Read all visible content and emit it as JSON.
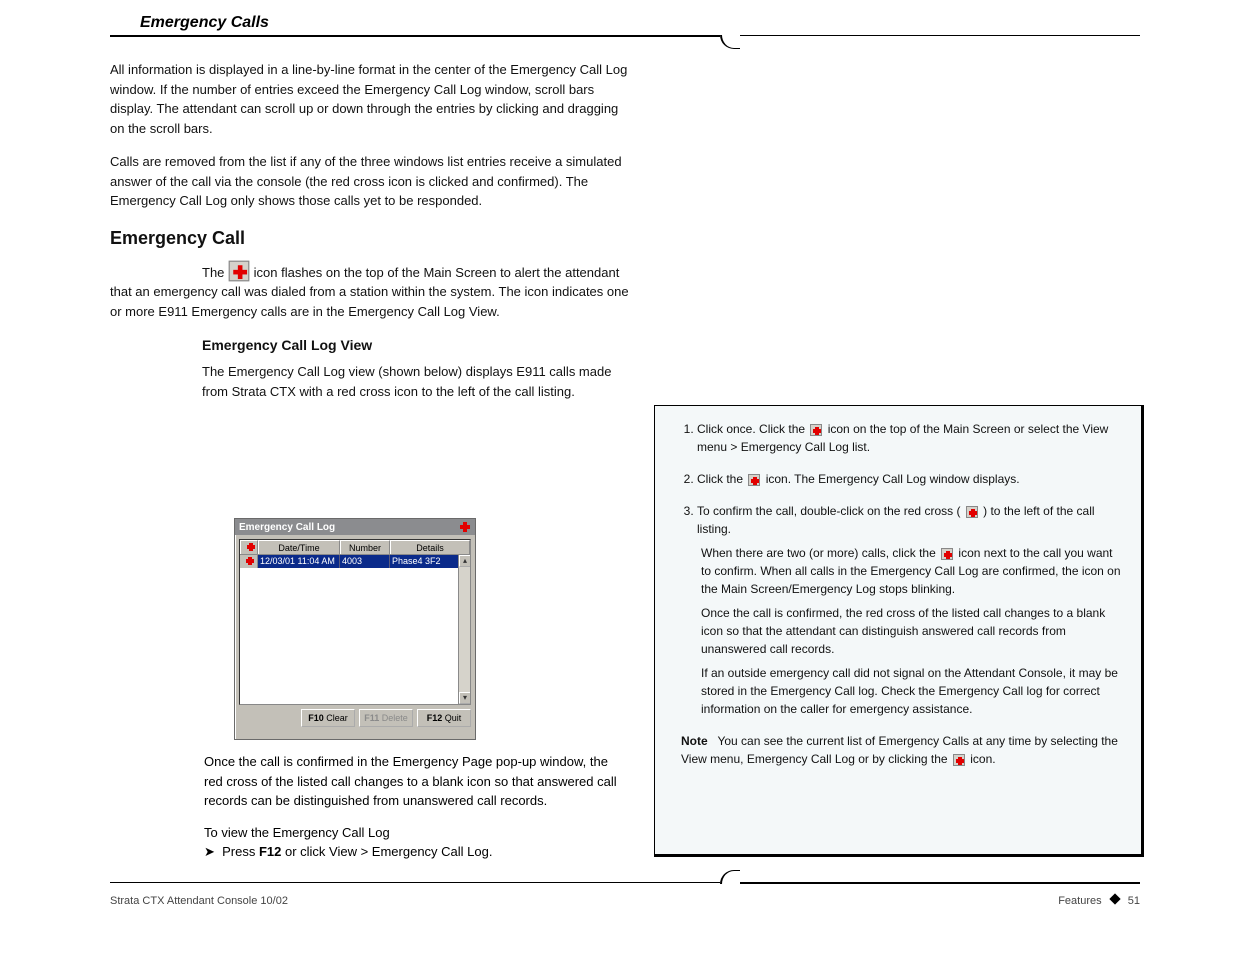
{
  "header": {
    "title": "Emergency Calls"
  },
  "footer": {
    "left": "Strata CTX Attendant Console    10/02",
    "right_label": "Features",
    "page": "51"
  },
  "left_body": {
    "intro1": "All information is displayed in a line-by-line format in the center of the Emergency Call Log window. If the number of entries exceed the Emergency Call Log window, scroll bars display. The attendant can scroll up or down through the entries by clicking and dragging on the scroll bars.",
    "intro2": "Calls are removed from the list if any of the three windows list entries receive a simulated answer of the call via the console (the red cross icon is clicked and confirmed). The Emergency Call Log only shows those calls yet to be responded.",
    "h_emcall": "Emergency Call",
    "emcall_p1_a": "The ",
    "emcall_p1_b": " icon flashes on the top of the Main Screen to alert the attendant that an emergency call was dialed from a station within the system. The ",
    "emcall_p1_c": " icon indicates one or more E911 Emergency calls are in the Emergency Call Log View.",
    "h_eclview": "Emergency Call Log View",
    "eclview_p": "The Emergency Call Log view (shown below) displays E911 calls made from Strata CTX with a red cross icon to the left of the call listing."
  },
  "figure": {
    "caption": ""
  },
  "ecl": {
    "title": "Emergency Call Log",
    "cols": {
      "icon": "",
      "date": "Date/Time",
      "number": "Number",
      "details": "Details"
    },
    "rows": [
      {
        "date": "12/03/01 11:04 AM",
        "number": "4003",
        "details": "Phase4 3F2"
      }
    ],
    "buttons": {
      "clear_key": "F10",
      "clear": " Clear",
      "delete_key": "F11",
      "delete": " Delete",
      "quit_key": "F12",
      "quit": " Quit"
    }
  },
  "below_fig": {
    "p1": "Once the call is confirmed in the Emergency Page pop-up window, the red cross of the listed call changes to a blank icon so that answered call records can be distinguished from unanswered call records.",
    "h_toview": "To view the Emergency Call Log",
    "p2_key": "F12",
    "p2_rest": " or click View > Emergency Call Log."
  },
  "stepbox": {
    "step1_a": "Click once. Click the ",
    "step1_b": " icon on the top of the Main Screen or select the View menu > Emergency Call Log list.",
    "step2_a": "Click the ",
    "step2_b": " icon. The Emergency Call Log window displays.",
    "step3_a": "To confirm the call, double-click on the red cross (",
    "step3_b": ") to the left of the call listing.",
    "step3_sub_a": "When there are two (or more) calls, click the ",
    "step3_sub_b": " icon next to the call you want to confirm. When all calls in the Emergency Call Log are confirmed, the icon on the Main Screen/Emergency Log stops blinking.",
    "step3_sub2": "Once the call is confirmed, the red cross of the listed call changes to a blank icon so that the attendant can distinguish answered call records from unanswered call records.",
    "step3_sub3": "If an outside emergency call did not signal on the Attendant Console, it may be stored in the Emergency Call log. Check the Emergency Call log for correct information on the caller for emergency assistance.",
    "note_label": "Note",
    "note_body_a": "You can see the current list of Emergency Calls at any time by selecting the View menu, Emergency Call Log or by clicking the ",
    "note_body_b": " icon."
  }
}
